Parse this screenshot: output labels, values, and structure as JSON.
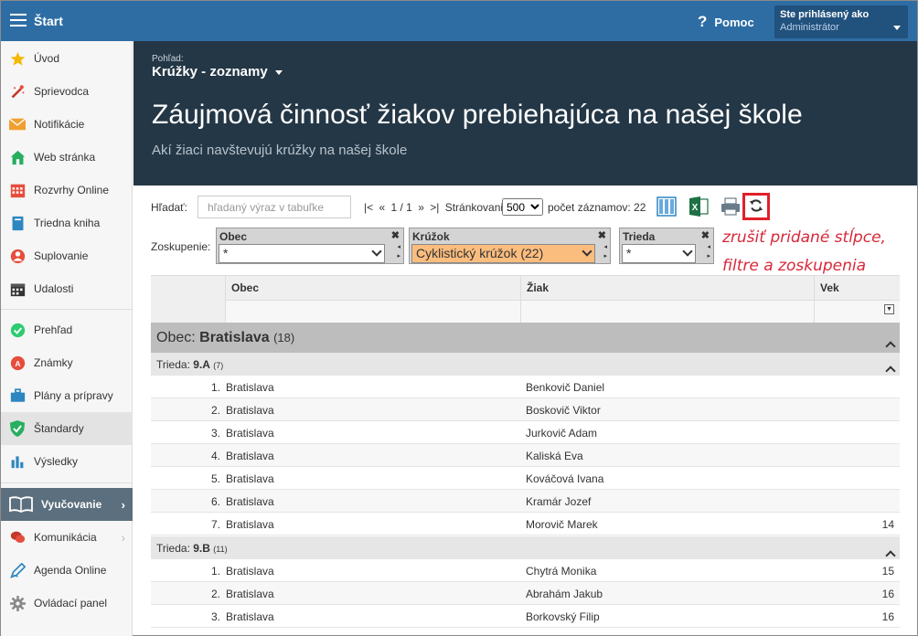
{
  "topbar": {
    "title": "Štart",
    "help_label": "Pomoc",
    "user_line1": "Ste prihlásený ako",
    "user_line2": "Administrátor"
  },
  "sidebar": {
    "items": [
      {
        "label": "Úvod",
        "icon": "star-icon"
      },
      {
        "label": "Sprievodca",
        "icon": "magic-wand-icon"
      },
      {
        "label": "Notifikácie",
        "icon": "envelope-icon"
      },
      {
        "label": "Web stránka",
        "icon": "house-icon"
      },
      {
        "label": "Rozvrhy Online",
        "icon": "calendar-grid-icon"
      },
      {
        "label": "Triedna kniha",
        "icon": "book-icon"
      },
      {
        "label": "Suplovanie",
        "icon": "person-icon"
      },
      {
        "label": "Udalosti",
        "icon": "calendar-icon"
      },
      {
        "label": "Prehľad",
        "icon": "check-circle-icon"
      },
      {
        "label": "Známky",
        "icon": "grade-icon"
      },
      {
        "label": "Plány a prípravy",
        "icon": "briefcase-icon"
      },
      {
        "label": "Štandardy",
        "icon": "shield-check-icon"
      },
      {
        "label": "Výsledky",
        "icon": "bar-chart-icon"
      },
      {
        "label": "Vyučovanie",
        "icon": "open-book-icon"
      },
      {
        "label": "Komunikácia",
        "icon": "chat-icon"
      },
      {
        "label": "Agenda Online",
        "icon": "pen-icon"
      },
      {
        "label": "Ovládací panel",
        "icon": "gear-icon"
      }
    ]
  },
  "header": {
    "view_label": "Pohľad:",
    "view_name": "Krúžky - zoznamy",
    "title": "Záujmová činnosť žiakov prebiehajúca na našej škole",
    "subtitle": "Akí žiaci navštevujú krúžky na našej škole"
  },
  "toolbar": {
    "search_label": "Hľadať:",
    "search_placeholder": "hľadaný výraz v tabuľke",
    "pager_first": "|<",
    "pager_prev": "«",
    "pager_page": "1 / 1",
    "pager_next": "»",
    "pager_last": ">|",
    "page_size_label": "Stránkovanie:",
    "page_size_value": "500",
    "count_label": "počet záznamov: 22"
  },
  "grouping": {
    "label": "Zoskupenie:",
    "groups": [
      {
        "title": "Obec",
        "value": "*"
      },
      {
        "title": "Krúžok",
        "value": "Cyklistický krúžok (22)"
      },
      {
        "title": "Trieda",
        "value": "*"
      }
    ]
  },
  "annotation": {
    "line1": "zrušiť pridané stĺpce,",
    "line2": "filtre a zoskupenia"
  },
  "table": {
    "columns": [
      "Obec",
      "Žiak",
      "Vek"
    ],
    "group1": {
      "prefix": "Obec:",
      "name": "Bratislava",
      "count": "(18)"
    },
    "group_a": {
      "prefix": "Trieda:",
      "name": "9.A",
      "count": "(7)"
    },
    "group_b": {
      "prefix": "Trieda:",
      "name": "9.B",
      "count": "(11)"
    },
    "rows_a": [
      {
        "num": "1.",
        "obec": "Bratislava",
        "ziak": "Benkovič Daniel",
        "vek": ""
      },
      {
        "num": "2.",
        "obec": "Bratislava",
        "ziak": "Boskovič Viktor",
        "vek": ""
      },
      {
        "num": "3.",
        "obec": "Bratislava",
        "ziak": "Jurkovič Adam",
        "vek": ""
      },
      {
        "num": "4.",
        "obec": "Bratislava",
        "ziak": "Kaliská Eva",
        "vek": ""
      },
      {
        "num": "5.",
        "obec": "Bratislava",
        "ziak": "Kováčová Ivana",
        "vek": ""
      },
      {
        "num": "6.",
        "obec": "Bratislava",
        "ziak": "Kramár Jozef",
        "vek": ""
      },
      {
        "num": "7.",
        "obec": "Bratislava",
        "ziak": "Morovič Marek",
        "vek": "14"
      }
    ],
    "rows_b": [
      {
        "num": "1.",
        "obec": "Bratislava",
        "ziak": "Chytrá Monika",
        "vek": "15"
      },
      {
        "num": "2.",
        "obec": "Bratislava",
        "ziak": "Abrahám Jakub",
        "vek": "16"
      },
      {
        "num": "3.",
        "obec": "Bratislava",
        "ziak": "Borkovský Filip",
        "vek": "16"
      }
    ]
  },
  "colors": {
    "topbar": "#2e6da4",
    "header_bg": "#243746",
    "section_bg": "#5c6f7e",
    "annotation_red": "#d8283a",
    "group_orange": "#fbbd7e"
  }
}
